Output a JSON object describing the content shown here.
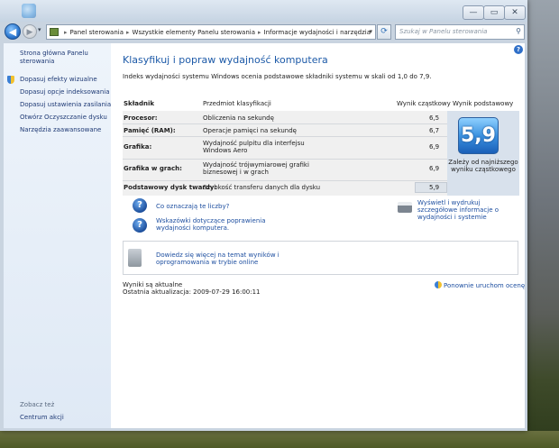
{
  "window": {
    "controls": {
      "minimize": "—",
      "maximize": "▭",
      "close": "✕"
    }
  },
  "address": {
    "segments": [
      "Panel sterowania",
      "Wszystkie elementy Panelu sterowania",
      "Informacje wydajności i narzędzia"
    ],
    "search_placeholder": "Szukaj w Panelu sterowania"
  },
  "sidebar": {
    "home": "Strona główna Panelu sterowania",
    "items": [
      "Dopasuj efekty wizualne",
      "Dopasuj opcje indeksowania",
      "Dopasuj ustawienia zasilania",
      "Otwórz Oczyszczanie dysku",
      "Narzędzia zaawansowane"
    ],
    "see_also": "Zobacz też",
    "action_center": "Centrum akcji"
  },
  "main": {
    "title": "Klasyfikuj i popraw wydajność komputera",
    "intro": "Indeks wydajności systemu Windows ocenia podstawowe składniki systemu w skali od 1,0 do 7,9.",
    "columns": {
      "component": "Składnik",
      "rated": "Przedmiot klasyfikacji",
      "subscore": "Wynik cząstkowy",
      "base": "Wynik podstawowy"
    },
    "rows": [
      {
        "name": "Procesor:",
        "desc": "Obliczenia na sekundę",
        "score": "6,5"
      },
      {
        "name": "Pamięć (RAM):",
        "desc": "Operacje pamięci na sekundę",
        "score": "6,7"
      },
      {
        "name": "Grafika:",
        "desc": "Wydajność pulpitu dla interfejsu Windows Aero",
        "score": "6,9"
      },
      {
        "name": "Grafika w grach:",
        "desc": "Wydajność trójwymiarowej grafiki biznesowej i w grach",
        "score": "6,9"
      },
      {
        "name": "Podstawowy dysk twardy:",
        "desc": "Szybkość transferu danych dla dysku",
        "score": "5,9"
      }
    ],
    "base_score": "5,9",
    "base_note": "Zależy od najniższego wyniku cząstkowego",
    "links": {
      "what_mean": "Co oznaczają te liczby?",
      "tips": "Wskazówki dotyczące poprawienia wydajności komputera.",
      "print": "Wyświetl i wydrukuj szczegółowe informacje o wydajności i systemie",
      "learn_more": "Dowiedz się więcej na temat wyników i oprogramowania w trybie online"
    },
    "status_current": "Wyniki są aktualne",
    "last_update": "Ostatnia aktualizacja: 2009-07-29 16:00:11",
    "rerun": "Ponownie uruchom ocenę"
  }
}
